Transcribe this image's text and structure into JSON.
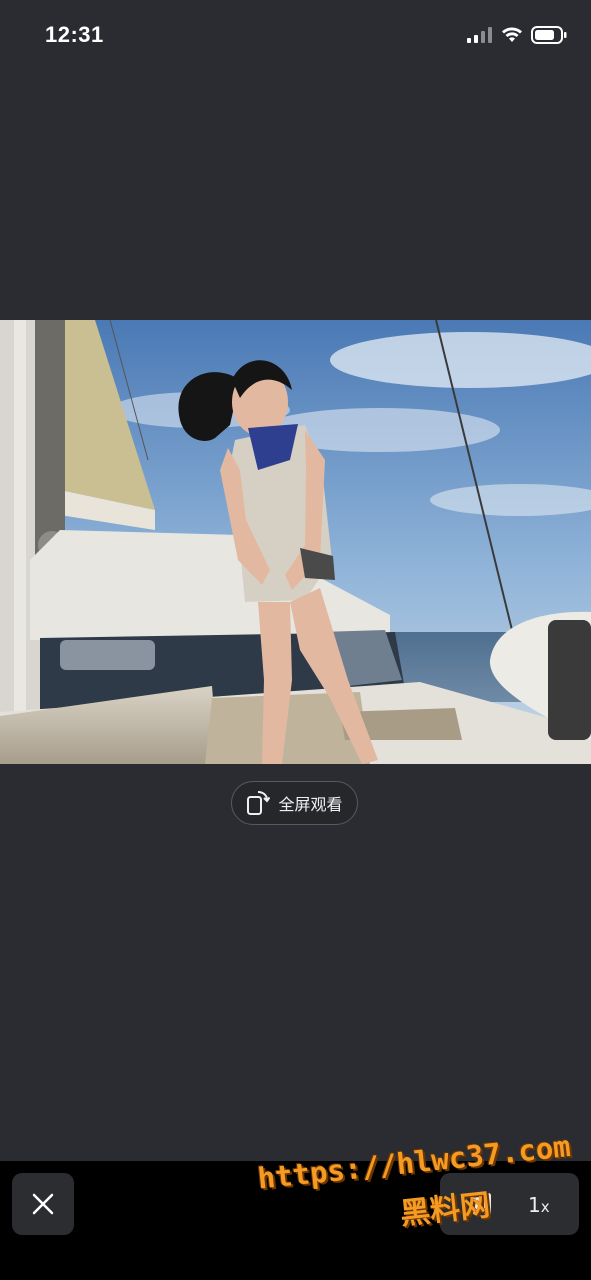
{
  "status_bar": {
    "time": "12:31",
    "icons": [
      "cellular-signal-icon",
      "wifi-icon",
      "battery-icon"
    ]
  },
  "video": {
    "content": "video-frame-image"
  },
  "fullscreen_button": {
    "label": "全屏观看",
    "icon": "rotate-phone-icon"
  },
  "bottom_bar": {
    "close_icon": "close-icon",
    "pause_icon": "pause-icon",
    "speed": "1",
    "speed_suffix": "x"
  },
  "watermark": {
    "url": "https://hlwc37.com",
    "name": "黑料网"
  },
  "colors": {
    "background": "#2a2c31",
    "bottom_bar": "#000000",
    "watermark": "#f59a22"
  }
}
